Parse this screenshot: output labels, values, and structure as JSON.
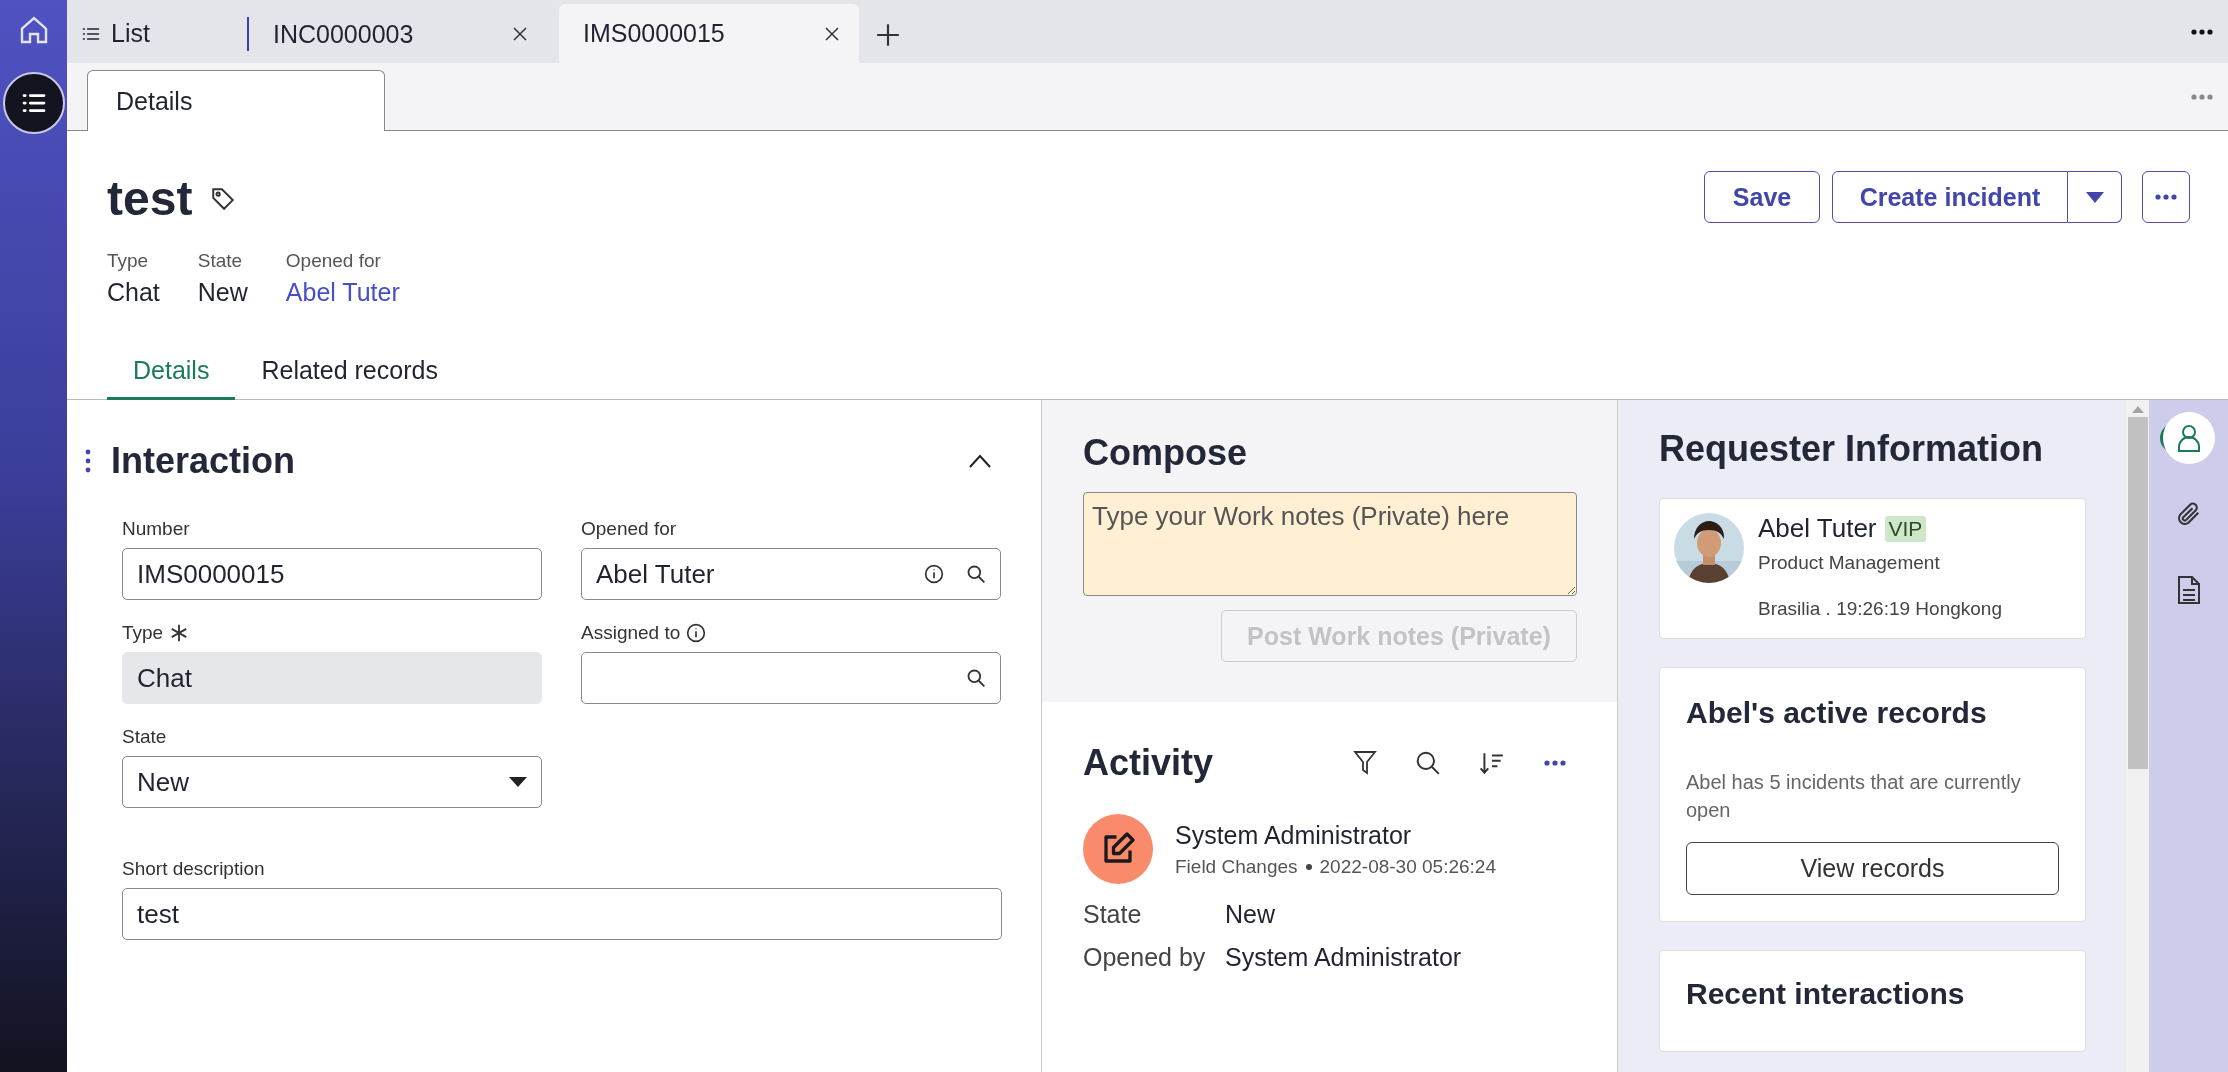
{
  "nav": {
    "items": [
      {
        "kind": "home",
        "selected": false
      },
      {
        "kind": "list",
        "selected": true
      }
    ]
  },
  "tabs": [
    {
      "label": "List",
      "kind": "list",
      "closable": false,
      "selected": false
    },
    {
      "label": "INC0000003",
      "kind": "record",
      "closable": true,
      "selected": false
    },
    {
      "label": "IMS0000015",
      "kind": "record",
      "closable": true,
      "selected": true
    }
  ],
  "subtabs": [
    {
      "label": "Details",
      "selected": true
    }
  ],
  "record": {
    "title": "test",
    "meta": [
      {
        "label": "Type",
        "value": "Chat",
        "kind": "text"
      },
      {
        "label": "State",
        "value": "New",
        "kind": "text"
      },
      {
        "label": "Opened for",
        "value": "Abel Tuter",
        "kind": "link"
      }
    ]
  },
  "actions": {
    "save": "Save",
    "primary": "Create incident"
  },
  "detail_tabs": [
    {
      "label": "Details",
      "selected": true
    },
    {
      "label": "Related records",
      "selected": false
    }
  ],
  "section": {
    "title": "Interaction",
    "expanded": true,
    "fields": [
      {
        "label": "Number",
        "value": "IMS0000015",
        "kind": "text"
      },
      {
        "label": "Opened for",
        "value": "Abel Tuter",
        "kind": "reference",
        "info": true
      },
      {
        "label": "Type",
        "value": "Chat",
        "kind": "readonly",
        "required": true
      },
      {
        "label": "Assigned to",
        "kind": "reference",
        "label_info": true
      },
      {
        "label": "State",
        "value": "New",
        "kind": "choice"
      },
      {
        "label": "Short description",
        "value": "test",
        "kind": "text",
        "wide": true
      }
    ]
  },
  "compose": {
    "title": "Compose",
    "placeholder": "Type your Work notes (Private) here",
    "post_button": {
      "label": "Post Work notes (Private)",
      "disabled": true
    }
  },
  "activity": {
    "title": "Activity",
    "entries": [
      {
        "author": "System Administrator",
        "type": "Field Changes",
        "time": "2022-08-30 05:26:24",
        "changes": [
          {
            "field": "State",
            "value": "New"
          },
          {
            "field": "Opened by",
            "value": "System Administrator"
          }
        ]
      }
    ]
  },
  "requester": {
    "title": "Requester Information",
    "name": "Abel Tuter",
    "badge": "VIP",
    "department": "Product Management",
    "location": "Brasilia . 19:26:19 Hongkong"
  },
  "active_records": {
    "title": "Abel's active records",
    "text": "Abel has 5 incidents that are currently open",
    "button": "View records"
  },
  "recent": {
    "title": "Recent interactions"
  },
  "rail": {
    "items": [
      {
        "kind": "person",
        "selected": true
      },
      {
        "kind": "attachment",
        "selected": false
      },
      {
        "kind": "document",
        "selected": false
      }
    ]
  }
}
